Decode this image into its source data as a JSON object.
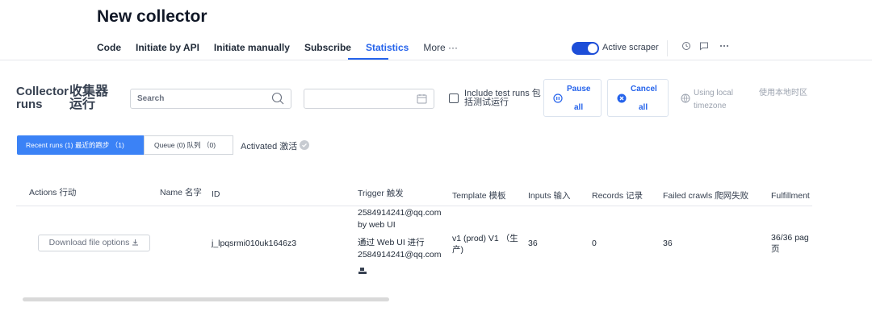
{
  "header": {
    "title": "New collector",
    "nav": [
      {
        "label": "Code"
      },
      {
        "label": "Initiate by API"
      },
      {
        "label": "Initiate manually"
      },
      {
        "label": "Subscribe"
      },
      {
        "label": "Statistics"
      },
      {
        "label": "More ···"
      }
    ],
    "active_tab": "Statistics",
    "scraper_toggle_label": "Active scraper",
    "scraper_toggle_on": true,
    "icons": [
      "clock-icon",
      "comment-icon",
      "more-icon"
    ]
  },
  "toolbar": {
    "title_en": "Collector runs",
    "title_zh": "收集器运行",
    "search_placeholder": "Search",
    "date_value": "",
    "include_test_label": "Include test runs 包括测试运行",
    "pause": {
      "line1": "Pause",
      "line2": "all"
    },
    "cancel": {
      "line1": "Cancel",
      "line2": "all"
    },
    "local_time_label": "Using local timezone",
    "local_time_zh": "使用本地时区"
  },
  "tabs": {
    "recent": "Recent runs (1) 最近的跑步 （1)",
    "queue": "Queue (0) 队列 （0)",
    "activated": "Activated 激活"
  },
  "table": {
    "columns": [
      "Actions 行动",
      "Name 名字",
      "ID",
      "Trigger 触发",
      "Template 模板",
      "Inputs 输入",
      "Records 记录",
      "Failed crawls 爬网失败",
      "Fulfillment 履"
    ],
    "rows": [
      {
        "action": "Download file options",
        "name": "",
        "id": "j_lpqsrmi010uk1646z3",
        "trigger_lines": [
          "2584914241@qq.com",
          "by web UI",
          "通过 Web UI 进行",
          "2584914241@qq.com"
        ],
        "template": "v1 (prod) V1 （生产)",
        "inputs": "36",
        "records": "0",
        "failed_crawls": "36",
        "fulfillment": "36/36 pag 页"
      }
    ]
  },
  "colors": {
    "accent": "#2563eb",
    "tab_active_bg": "#3b82f6",
    "toggle_on": "#1d4ed8"
  }
}
